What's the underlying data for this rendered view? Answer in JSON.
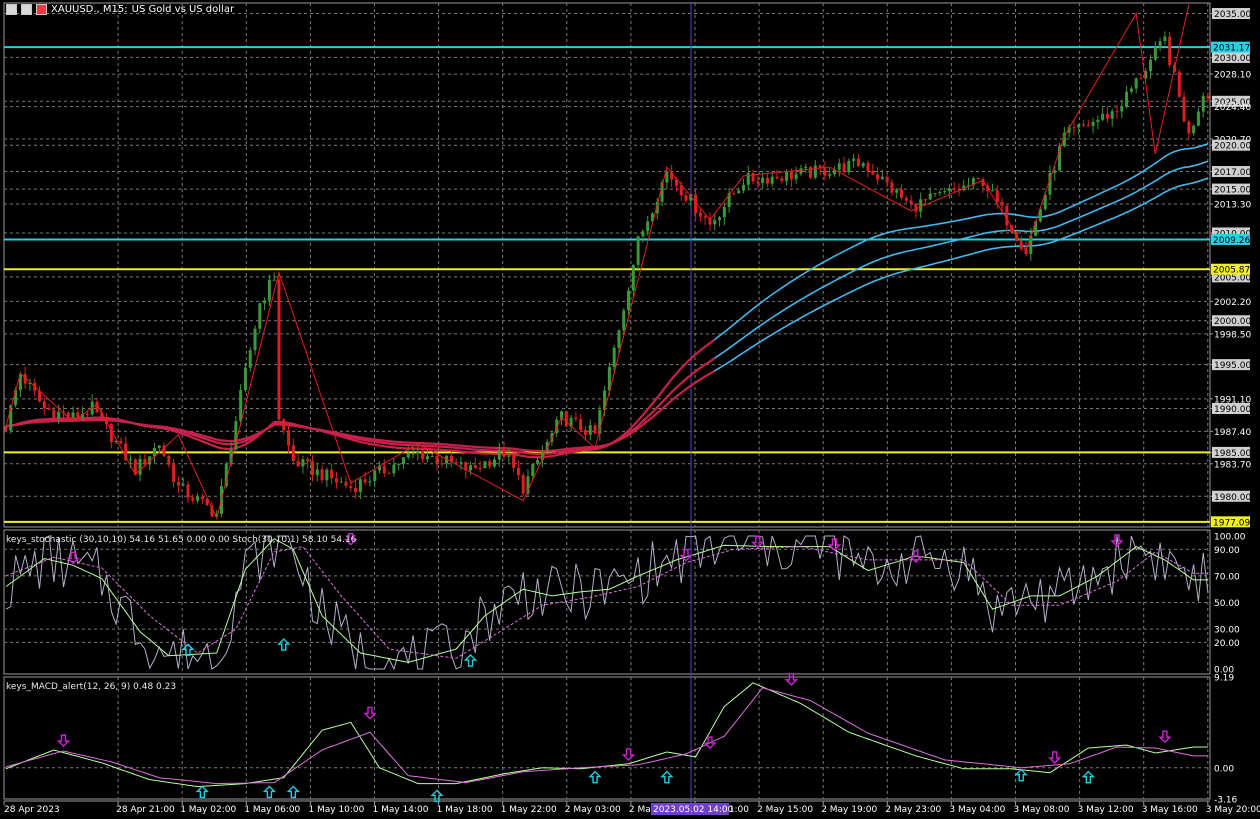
{
  "header": {
    "symbol": "XAUUSD., M15:",
    "description": "US Gold vs US dollar"
  },
  "colors": {
    "bg": "#000000",
    "grid": "#7a7a7a",
    "bull": "#3a9a3a",
    "bear": "#e02020",
    "hline_cyan": "#22d3e6",
    "hline_yellow": "#f0f020",
    "ma_red": "#c8204a",
    "ma_blue": "#3fb8ee",
    "stoch_main": "#b8ff9a",
    "stoch_signal": "#e070e0",
    "raw": "#b0b0c8",
    "arrow_up": "#18d0e0",
    "arrow_down": "#d020d8",
    "vline": "#6040c0",
    "zigzag": "#e02020"
  },
  "chart_data": [
    {
      "type": "candlestick",
      "title": "XAUUSD., M15: US Gold vs US dollar",
      "ylim": [
        1976.5,
        2036.2
      ],
      "yticks": [
        "2035.00",
        "2030.00",
        "2028.10",
        "2025.00",
        "2024.40",
        "2020.70",
        "2020.00",
        "2017.00",
        "2015.00",
        "2013.30",
        "2010.00",
        "2005.00",
        "2002.20",
        "2000.00",
        "1998.50",
        "1995.00",
        "1991.10",
        "1990.00",
        "1987.40",
        "1985.00",
        "1983.70",
        "1980.00"
      ],
      "price_labels": [
        {
          "text": "2031.17",
          "kind": "cyan"
        },
        {
          "text": "2009.26",
          "kind": "cyan"
        },
        {
          "text": "2005.87",
          "kind": "yellow"
        },
        {
          "text": "1977.09",
          "kind": "yellow"
        }
      ],
      "hlines": [
        {
          "value": 2031.17,
          "color": "cyan"
        },
        {
          "value": 2009.26,
          "color": "cyan"
        },
        {
          "value": 2005.87,
          "color": "yellow"
        },
        {
          "value": 1985.0,
          "color": "yellow"
        },
        {
          "value": 1977.09,
          "color": "yellow"
        }
      ],
      "xticks": [
        "28 Apr 2023",
        "28 Apr 21:00",
        "1 May 02:00",
        "1 May 06:00",
        "1 May 10:00",
        "1 May 14:00",
        "1 May 18:00",
        "1 May 22:00",
        "2 May 03:00",
        "2 May 07:00",
        "2 May 11:00",
        "2 May 15:00",
        "2 May 19:00",
        "2 May 23:00",
        "3 May 04:00",
        "3 May 08:00",
        "3 May 12:00",
        "3 May 16:00",
        "3 May 20:00"
      ],
      "crosshair_label": "2023.05.02 14:00",
      "series_ohlc_keyframes": [
        {
          "x": 0,
          "close": 1988
        },
        {
          "x": 3,
          "close": 1994
        },
        {
          "x": 8,
          "close": 1990
        },
        {
          "x": 14,
          "close": 1989
        },
        {
          "x": 18,
          "close": 1990
        },
        {
          "x": 27,
          "close": 1983
        },
        {
          "x": 32,
          "close": 1986
        },
        {
          "x": 36,
          "close": 1981
        },
        {
          "x": 44,
          "close": 1978
        },
        {
          "x": 53,
          "close": 2002
        },
        {
          "x": 56,
          "close": 2005
        },
        {
          "x": 57,
          "close": 1989
        },
        {
          "x": 60,
          "close": 1984
        },
        {
          "x": 72,
          "close": 1981
        },
        {
          "x": 86,
          "close": 1985
        },
        {
          "x": 97,
          "close": 1983
        },
        {
          "x": 104,
          "close": 1985
        },
        {
          "x": 108,
          "close": 1981
        },
        {
          "x": 116,
          "close": 1989
        },
        {
          "x": 123,
          "close": 1987
        },
        {
          "x": 132,
          "close": 2009
        },
        {
          "x": 138,
          "close": 2017
        },
        {
          "x": 147,
          "close": 2011
        },
        {
          "x": 154,
          "close": 2016
        },
        {
          "x": 170,
          "close": 2017
        },
        {
          "x": 179,
          "close": 2018
        },
        {
          "x": 189,
          "close": 2013
        },
        {
          "x": 204,
          "close": 2016
        },
        {
          "x": 213,
          "close": 2008
        },
        {
          "x": 221,
          "close": 2021
        },
        {
          "x": 232,
          "close": 2024
        },
        {
          "x": 242,
          "close": 2032
        },
        {
          "x": 247,
          "close": 2021
        },
        {
          "x": 250,
          "close": 2026
        }
      ],
      "zigzag_keyframes": [
        {
          "x": 0,
          "y": 1988
        },
        {
          "x": 3,
          "y": 1994
        },
        {
          "x": 14,
          "y": 1988.5
        },
        {
          "x": 19,
          "y": 1990.5
        },
        {
          "x": 27,
          "y": 1982.5
        },
        {
          "x": 36,
          "y": 1987
        },
        {
          "x": 44,
          "y": 1977.5
        },
        {
          "x": 57,
          "y": 2005.5
        },
        {
          "x": 72,
          "y": 1981.5
        },
        {
          "x": 86,
          "y": 1986
        },
        {
          "x": 108,
          "y": 1979.5
        },
        {
          "x": 116,
          "y": 1989
        },
        {
          "x": 123,
          "y": 1985.5
        },
        {
          "x": 138,
          "y": 2017.5
        },
        {
          "x": 147,
          "y": 2011.5
        },
        {
          "x": 154,
          "y": 2016.5
        },
        {
          "x": 172,
          "y": 2017.5
        },
        {
          "x": 189,
          "y": 2012.5
        },
        {
          "x": 204,
          "y": 2016
        },
        {
          "x": 213,
          "y": 2008
        },
        {
          "x": 221,
          "y": 2021
        },
        {
          "x": 236,
          "y": 2035
        },
        {
          "x": 240,
          "y": 2019
        },
        {
          "x": 247,
          "y": 2036
        }
      ]
    },
    {
      "type": "line",
      "title": "keys_stochastic (30,10,10) 54.16 51.65 0.00 0.00 Stoch(30,10,1) 58.10 54.16",
      "ylim": [
        0,
        100
      ],
      "yticks": [
        "100.00",
        "90.00",
        "70.00",
        "50.00",
        "30.00",
        "20.00",
        "0.00"
      ],
      "series": [
        {
          "name": "main",
          "keyframes": [
            {
              "x": 0,
              "y": 62
            },
            {
              "x": 8,
              "y": 83
            },
            {
              "x": 14,
              "y": 78
            },
            {
              "x": 20,
              "y": 68
            },
            {
              "x": 28,
              "y": 28
            },
            {
              "x": 34,
              "y": 10
            },
            {
              "x": 44,
              "y": 12
            },
            {
              "x": 50,
              "y": 75
            },
            {
              "x": 56,
              "y": 98
            },
            {
              "x": 60,
              "y": 90
            },
            {
              "x": 66,
              "y": 40
            },
            {
              "x": 74,
              "y": 12
            },
            {
              "x": 84,
              "y": 5
            },
            {
              "x": 94,
              "y": 15
            },
            {
              "x": 100,
              "y": 40
            },
            {
              "x": 108,
              "y": 60
            },
            {
              "x": 114,
              "y": 55
            },
            {
              "x": 120,
              "y": 58
            },
            {
              "x": 126,
              "y": 60
            },
            {
              "x": 132,
              "y": 70
            },
            {
              "x": 140,
              "y": 82
            },
            {
              "x": 150,
              "y": 93
            },
            {
              "x": 160,
              "y": 92
            },
            {
              "x": 172,
              "y": 92
            },
            {
              "x": 180,
              "y": 74
            },
            {
              "x": 190,
              "y": 85
            },
            {
              "x": 200,
              "y": 80
            },
            {
              "x": 206,
              "y": 45
            },
            {
              "x": 214,
              "y": 55
            },
            {
              "x": 220,
              "y": 55
            },
            {
              "x": 228,
              "y": 70
            },
            {
              "x": 236,
              "y": 92
            },
            {
              "x": 242,
              "y": 82
            },
            {
              "x": 248,
              "y": 67
            }
          ]
        },
        {
          "name": "signal",
          "keyframes": [
            {
              "x": 0,
              "y": 70
            },
            {
              "x": 10,
              "y": 84
            },
            {
              "x": 20,
              "y": 76
            },
            {
              "x": 30,
              "y": 40
            },
            {
              "x": 40,
              "y": 12
            },
            {
              "x": 48,
              "y": 30
            },
            {
              "x": 56,
              "y": 88
            },
            {
              "x": 62,
              "y": 92
            },
            {
              "x": 70,
              "y": 55
            },
            {
              "x": 80,
              "y": 15
            },
            {
              "x": 94,
              "y": 8
            },
            {
              "x": 104,
              "y": 30
            },
            {
              "x": 112,
              "y": 48
            },
            {
              "x": 122,
              "y": 54
            },
            {
              "x": 132,
              "y": 62
            },
            {
              "x": 142,
              "y": 80
            },
            {
              "x": 152,
              "y": 90
            },
            {
              "x": 166,
              "y": 92
            },
            {
              "x": 180,
              "y": 82
            },
            {
              "x": 192,
              "y": 82
            },
            {
              "x": 200,
              "y": 82
            },
            {
              "x": 210,
              "y": 48
            },
            {
              "x": 220,
              "y": 48
            },
            {
              "x": 232,
              "y": 66
            },
            {
              "x": 240,
              "y": 88
            },
            {
              "x": 248,
              "y": 72
            }
          ]
        }
      ],
      "arrows": [
        {
          "x": 14,
          "y": 84,
          "dir": "down"
        },
        {
          "x": 38,
          "y": 14,
          "dir": "up"
        },
        {
          "x": 58,
          "y": 18,
          "dir": "up"
        },
        {
          "x": 72,
          "y": 98,
          "dir": "down"
        },
        {
          "x": 97,
          "y": 6,
          "dir": "up"
        },
        {
          "x": 142,
          "y": 86,
          "dir": "down"
        },
        {
          "x": 157,
          "y": 96,
          "dir": "down"
        },
        {
          "x": 173,
          "y": 94,
          "dir": "down"
        },
        {
          "x": 190,
          "y": 85,
          "dir": "down"
        },
        {
          "x": 232,
          "y": 97,
          "dir": "down"
        }
      ]
    },
    {
      "type": "line",
      "title": "keys_MACD_alert(12, 26, 9) 0.48 0.23",
      "ylim": [
        -3.16,
        9.19
      ],
      "yticks": [
        "9.19",
        "0.00",
        "-3.16"
      ],
      "series": [
        {
          "name": "macd",
          "keyframes": [
            {
              "x": 0,
              "y": -0.1
            },
            {
              "x": 10,
              "y": 1.8
            },
            {
              "x": 20,
              "y": 0.5
            },
            {
              "x": 30,
              "y": -1.2
            },
            {
              "x": 40,
              "y": -1.9
            },
            {
              "x": 50,
              "y": -1.6
            },
            {
              "x": 58,
              "y": -1.0
            },
            {
              "x": 66,
              "y": 3.8
            },
            {
              "x": 72,
              "y": 4.6
            },
            {
              "x": 78,
              "y": 0.0
            },
            {
              "x": 86,
              "y": -1.6
            },
            {
              "x": 94,
              "y": -1.6
            },
            {
              "x": 104,
              "y": -0.6
            },
            {
              "x": 112,
              "y": 0.0
            },
            {
              "x": 120,
              "y": -0.1
            },
            {
              "x": 130,
              "y": 0.4
            },
            {
              "x": 138,
              "y": 1.6
            },
            {
              "x": 144,
              "y": 1.1
            },
            {
              "x": 150,
              "y": 6.2
            },
            {
              "x": 156,
              "y": 8.6
            },
            {
              "x": 166,
              "y": 6.5
            },
            {
              "x": 176,
              "y": 3.6
            },
            {
              "x": 190,
              "y": 1.2
            },
            {
              "x": 200,
              "y": -0.1
            },
            {
              "x": 210,
              "y": -0.1
            },
            {
              "x": 218,
              "y": -0.5
            },
            {
              "x": 226,
              "y": 2.0
            },
            {
              "x": 234,
              "y": 2.3
            },
            {
              "x": 240,
              "y": 1.5
            },
            {
              "x": 248,
              "y": 2.1
            }
          ]
        },
        {
          "name": "signal",
          "keyframes": [
            {
              "x": 0,
              "y": 0.1
            },
            {
              "x": 12,
              "y": 1.7
            },
            {
              "x": 22,
              "y": 0.6
            },
            {
              "x": 32,
              "y": -1.0
            },
            {
              "x": 44,
              "y": -1.6
            },
            {
              "x": 56,
              "y": -1.5
            },
            {
              "x": 66,
              "y": 1.8
            },
            {
              "x": 76,
              "y": 3.6
            },
            {
              "x": 84,
              "y": -0.8
            },
            {
              "x": 96,
              "y": -1.5
            },
            {
              "x": 108,
              "y": -0.4
            },
            {
              "x": 120,
              "y": 0.0
            },
            {
              "x": 132,
              "y": 0.3
            },
            {
              "x": 142,
              "y": 1.4
            },
            {
              "x": 150,
              "y": 3.2
            },
            {
              "x": 158,
              "y": 8.1
            },
            {
              "x": 168,
              "y": 6.8
            },
            {
              "x": 180,
              "y": 3.5
            },
            {
              "x": 196,
              "y": 0.8
            },
            {
              "x": 212,
              "y": 0.0
            },
            {
              "x": 222,
              "y": 0.4
            },
            {
              "x": 232,
              "y": 2.1
            },
            {
              "x": 240,
              "y": 2.0
            },
            {
              "x": 248,
              "y": 1.2
            }
          ]
        }
      ],
      "arrows": [
        {
          "x": 12,
          "y": 2.8,
          "dir": "down"
        },
        {
          "x": 41,
          "y": -2.5,
          "dir": "up"
        },
        {
          "x": 55,
          "y": -2.5,
          "dir": "up"
        },
        {
          "x": 60,
          "y": -2.5,
          "dir": "up"
        },
        {
          "x": 76,
          "y": 5.6,
          "dir": "down"
        },
        {
          "x": 90,
          "y": -2.9,
          "dir": "up"
        },
        {
          "x": 123,
          "y": -1.0,
          "dir": "up"
        },
        {
          "x": 130,
          "y": 1.4,
          "dir": "down"
        },
        {
          "x": 138,
          "y": -1.0,
          "dir": "up"
        },
        {
          "x": 147,
          "y": 2.6,
          "dir": "down"
        },
        {
          "x": 164,
          "y": 9.0,
          "dir": "down"
        },
        {
          "x": 212,
          "y": -0.8,
          "dir": "up"
        },
        {
          "x": 219,
          "y": 1.1,
          "dir": "down"
        },
        {
          "x": 226,
          "y": -1.0,
          "dir": "up"
        },
        {
          "x": 242,
          "y": 3.2,
          "dir": "down"
        }
      ]
    }
  ]
}
